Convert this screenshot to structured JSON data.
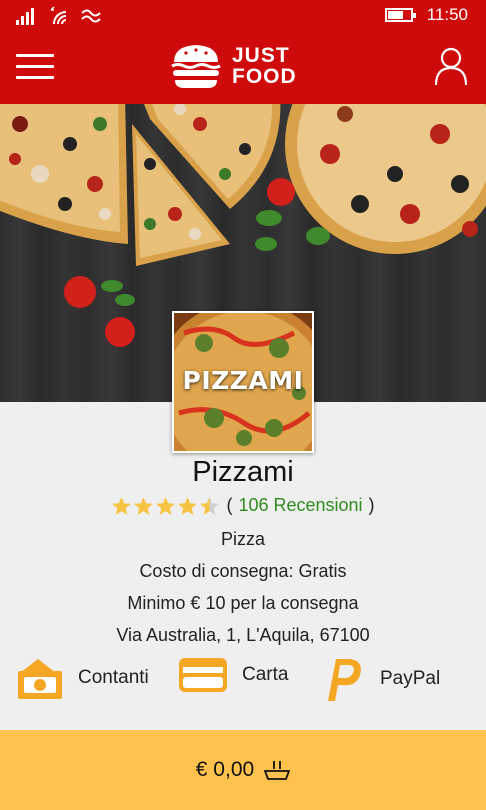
{
  "status_bar": {
    "time": "11:50",
    "battery_level": 0.7
  },
  "header": {
    "logo_line1": "JUST",
    "logo_line2": "FOOD",
    "menu_icon": "hamburger-icon",
    "user_icon": "user-icon"
  },
  "restaurant": {
    "logo_text": "PIZZAMI",
    "name": "Pizzami",
    "rating": 4.5,
    "rating_max": 5,
    "reviews_label": "106 Recensioni",
    "category": "Pizza",
    "delivery_cost": "Costo di consegna: Gratis",
    "minimum_order": "Minimo € 10 per la consegna",
    "address": "Via Australia, 1, L'Aquila, 67100"
  },
  "payments": [
    {
      "label": "Contanti",
      "icon": "cash-icon"
    },
    {
      "label": "Carta",
      "icon": "credit-card-icon"
    },
    {
      "label": "PayPal",
      "icon": "paypal-icon"
    }
  ],
  "cart": {
    "total": "€ 0,00",
    "icon": "basket-icon"
  },
  "colors": {
    "brand_red": "#cf0a0a",
    "accent_orange": "#f5a623",
    "star_yellow": "#f6c343",
    "link_green": "#2f8d1f",
    "cart_bar": "#ffc34d"
  }
}
